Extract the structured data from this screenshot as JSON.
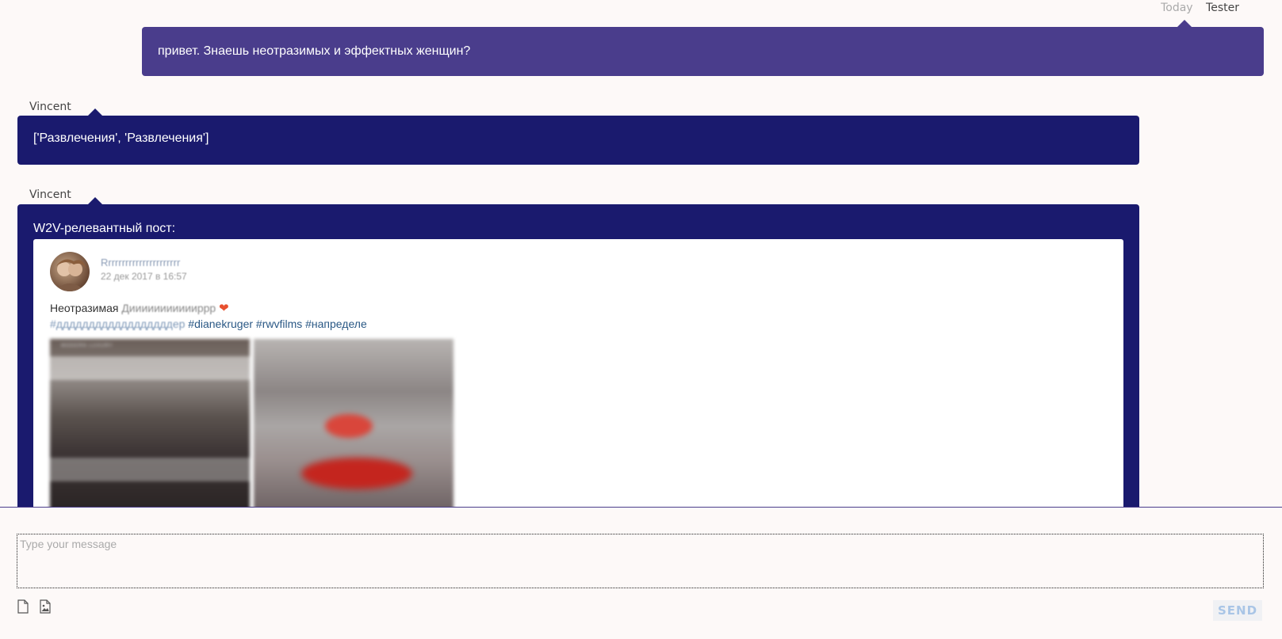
{
  "outgoing": {
    "time": "Today",
    "author": "Tester",
    "text": "привет. Знаешь неотразимых и эффектных женщин?"
  },
  "incoming": [
    {
      "sender": "Vincent",
      "text": "['Развлечения', 'Развлечения']"
    },
    {
      "sender": "Vincent",
      "heading": "W2V-релевантный пост:"
    }
  ],
  "post": {
    "author": "Rrrrrrrrrrrrrrrrrrrrrr",
    "date": "22 дек 2017 в 16:57",
    "text_visible": "Неотразимая",
    "text_blurred": "Диииииииииииррр",
    "emoji": "❤️",
    "tags_blurred": "#ддддддддддддддддддер",
    "tags": "#dianekruger #rwvfilms #напределе",
    "magazine_label": "MODERN LUXURY"
  },
  "composer": {
    "placeholder": "Type your message",
    "send_label": "SEND",
    "file_icon": "file-icon",
    "image_icon": "image-icon"
  }
}
